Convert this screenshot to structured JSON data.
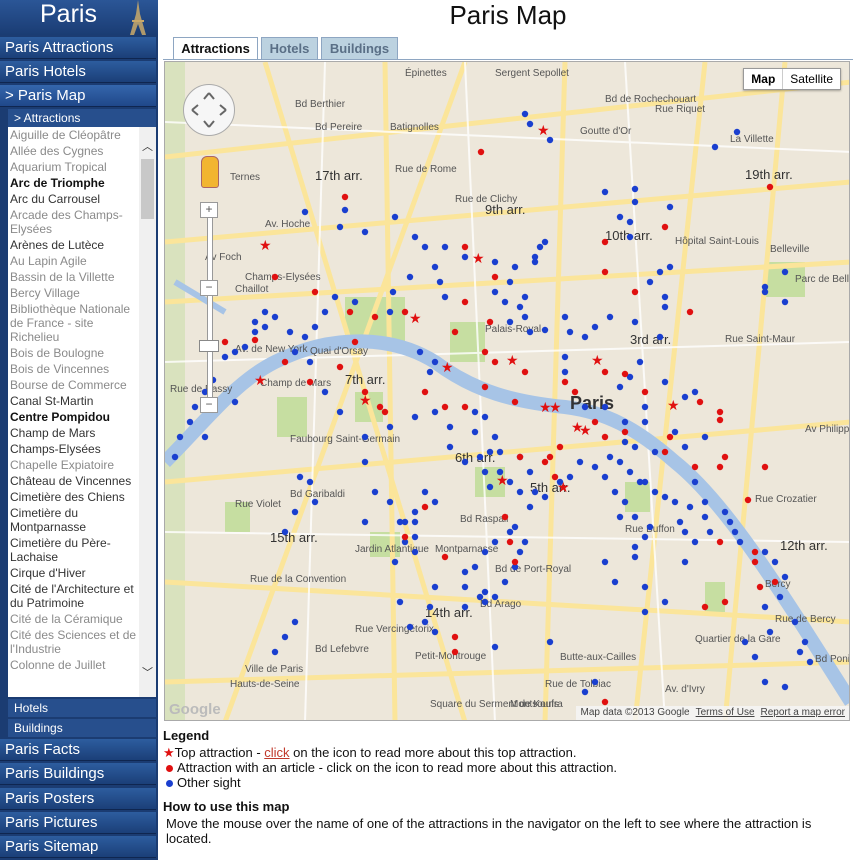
{
  "brand": {
    "title": "Paris"
  },
  "nav_top": [
    {
      "label": "Paris Attractions"
    },
    {
      "label": "Paris Hotels"
    },
    {
      "label": "> Paris Map"
    }
  ],
  "submenu": {
    "attractions": "> Attractions",
    "hotels": "Hotels",
    "buildings": "Buildings"
  },
  "attractions": [
    {
      "label": "Aiguille de Cléopâtre",
      "style": "dim"
    },
    {
      "label": "Allée des Cygnes",
      "style": "dim"
    },
    {
      "label": "Aquarium Tropical",
      "style": "dim"
    },
    {
      "label": "Arc de Triomphe",
      "style": "bold"
    },
    {
      "label": "Arc du Carrousel",
      "style": "normal"
    },
    {
      "label": "Arcade des Champs-Elysées",
      "style": "dim"
    },
    {
      "label": "Arènes de Lutèce",
      "style": "normal"
    },
    {
      "label": "Au Lapin Agile",
      "style": "dim"
    },
    {
      "label": "Bassin de la Villette",
      "style": "dim"
    },
    {
      "label": "Bercy Village",
      "style": "dim"
    },
    {
      "label": "Bibliothèque Nationale de France - site Richelieu",
      "style": "dim"
    },
    {
      "label": "Bois de Boulogne",
      "style": "dim"
    },
    {
      "label": "Bois de Vincennes",
      "style": "dim"
    },
    {
      "label": "Bourse de Commerce",
      "style": "dim"
    },
    {
      "label": "Canal St-Martin",
      "style": "normal"
    },
    {
      "label": "Centre Pompidou",
      "style": "bold"
    },
    {
      "label": "Champ de Mars",
      "style": "normal"
    },
    {
      "label": "Champs-Elysées",
      "style": "normal"
    },
    {
      "label": "Chapelle Expiatoire",
      "style": "dim"
    },
    {
      "label": "Château de Vincennes",
      "style": "normal"
    },
    {
      "label": "Cimetière des Chiens",
      "style": "normal"
    },
    {
      "label": "Cimetière du Montparnasse",
      "style": "normal"
    },
    {
      "label": "Cimetière du Père-Lachaise",
      "style": "normal"
    },
    {
      "label": "Cirque d'Hiver",
      "style": "normal"
    },
    {
      "label": "Cité de l'Architecture et du Patrimoine",
      "style": "normal"
    },
    {
      "label": "Cité de la Céramique",
      "style": "dim"
    },
    {
      "label": "Cité des Sciences et de l'Industrie",
      "style": "dim"
    },
    {
      "label": "Colonne de Juillet",
      "style": "dim"
    }
  ],
  "nav_bottom": [
    {
      "label": "Paris Facts"
    },
    {
      "label": "Paris Buildings"
    },
    {
      "label": "Paris Posters"
    },
    {
      "label": "Paris Pictures"
    },
    {
      "label": "Paris Sitemap"
    }
  ],
  "page_title": "Paris Map",
  "tabs": [
    {
      "label": "Attractions"
    },
    {
      "label": "Hotels"
    },
    {
      "label": "Buildings"
    }
  ],
  "map": {
    "type_map": "Map",
    "type_satellite": "Satellite",
    "footer_data": "Map data ©2013 Google",
    "footer_terms": "Terms of Use",
    "footer_report": "Report a map error",
    "google_logo": "Google",
    "labels": [
      "Épinettes",
      "Sergent Sepollet",
      "Bd Berthier",
      "Bd Pereire",
      "Batignolles",
      "Goutte d'Or",
      "La Villette",
      "Rue Riquet",
      "Ternes",
      "17th arr.",
      "9th arr.",
      "19th arr.",
      "Av. Hoche",
      "10th arr.",
      "Hôpital Saint-Louis",
      "Belleville",
      "Av Foch",
      "Champs-Elysées",
      "Chaillot",
      "Parc de Belleville",
      "Palais-Royal",
      "3rd arr.",
      "Av. de New York",
      "Quai d'Orsay",
      "7th arr.",
      "Paris",
      "Champ de Mars",
      "Rue de Passy",
      "Faubourg Saint-Germain",
      "6th arr.",
      "5th arr.",
      "Bd Garibaldi",
      "Rue Violet",
      "15th arr.",
      "Jardin Atlantique",
      "Montparnasse",
      "Bd de Port-Royal",
      "Rue Buffon",
      "12th arr.",
      "14th arr.",
      "Bd Arago",
      "Bercy",
      "Quartier de la Gare",
      "Petit-Montrouge",
      "Butte-aux-Cailles",
      "Rue de Tolbiac",
      "Bd Lefebvre",
      "Ville de Paris",
      "Square du Serment de Koufra",
      "Montsouris",
      "Hauts-de-Seine",
      "Rue de Bercy",
      "Bd Poniatowski",
      "Rue Crozatier",
      "Av Philippe-Auguste",
      "Rue Saint-Maur",
      "Rue de Rome",
      "Rue de Clichy",
      "Bd Raspail",
      "Rue de la Convention",
      "Rue Vercingétorix",
      "Av. d'Ivry",
      "Bd de Rochechouart"
    ],
    "icon_top": "star-icon",
    "icon_article": "red-dot-icon",
    "icon_other": "blue-dot-icon",
    "colors": {
      "top": "#e01010",
      "article": "#e01010",
      "other": "#1a3fcf",
      "water": "#a7c4e6",
      "park": "#c6dea1",
      "road": "#fbe59a"
    }
  },
  "legend": {
    "heading": "Legend",
    "top_prefix": "Top attraction - ",
    "top_link": "click",
    "top_suffix": " on the icon to read more about this top attraction.",
    "article": "Attraction with an article - click on the icon to read more about this attraction.",
    "other": "Other sight",
    "howto_heading": "How to use this map",
    "howto_text": "Move the mouse over the name of one of the attractions in the navigator on the left to see where the attraction is located."
  }
}
